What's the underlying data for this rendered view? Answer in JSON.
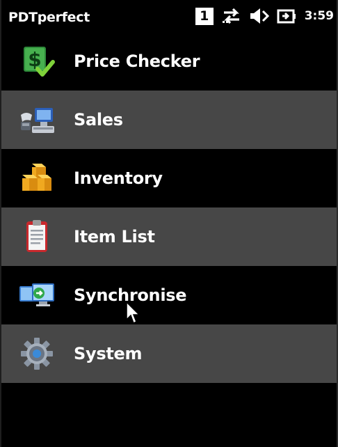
{
  "statusbar": {
    "app_title": "PDTperfect",
    "notification_count": "1",
    "clock": "3:59",
    "icons": [
      "notification-box",
      "connectivity-arrows-icon",
      "speaker-muted-icon",
      "battery-plug-icon"
    ]
  },
  "menu": {
    "items": [
      {
        "label": "Price Checker",
        "icon": "price-checker-icon"
      },
      {
        "label": "Sales",
        "icon": "sales-terminal-icon"
      },
      {
        "label": "Inventory",
        "icon": "inventory-boxes-icon"
      },
      {
        "label": "Item List",
        "icon": "clipboard-icon"
      },
      {
        "label": "Synchronise",
        "icon": "sync-monitor-icon"
      },
      {
        "label": "System",
        "icon": "gear-icon"
      }
    ]
  },
  "colors": {
    "background": "#000000",
    "alt_row": "#474747",
    "text": "#ffffff"
  }
}
